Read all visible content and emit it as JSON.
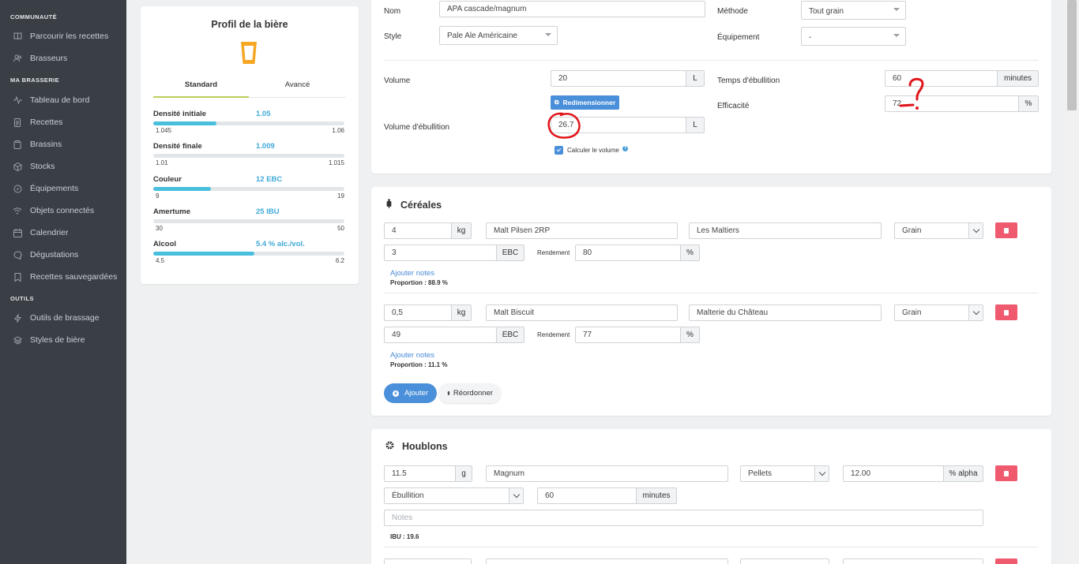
{
  "sidebar": {
    "sections": [
      {
        "label": "COMMUNAUTÉ",
        "items": [
          {
            "label": "Parcourir les recettes",
            "icon": "book-icon"
          },
          {
            "label": "Brasseurs",
            "icon": "users-icon"
          }
        ]
      },
      {
        "label": "MA BRASSERIE",
        "items": [
          {
            "label": "Tableau de bord",
            "icon": "pulse-icon"
          },
          {
            "label": "Recettes",
            "icon": "document-icon"
          },
          {
            "label": "Brassins",
            "icon": "clipboard-icon"
          },
          {
            "label": "Stocks",
            "icon": "box-icon"
          },
          {
            "label": "Équipements",
            "icon": "compass-icon"
          },
          {
            "label": "Objets connectés",
            "icon": "wifi-icon"
          },
          {
            "label": "Calendrier",
            "icon": "calendar-icon"
          },
          {
            "label": "Dégustations",
            "icon": "chat-icon"
          },
          {
            "label": "Recettes sauvegardées",
            "icon": "bookmark-icon"
          }
        ]
      },
      {
        "label": "OUTILS",
        "items": [
          {
            "label": "Outils de brassage",
            "icon": "bolt-icon"
          },
          {
            "label": "Styles de bière",
            "icon": "layers-icon"
          }
        ]
      }
    ]
  },
  "profile": {
    "title": "Profil de la bière",
    "icon": "beer-glass-icon",
    "tabs": [
      "Standard",
      "Avancé"
    ],
    "rows": [
      {
        "label": "Densité initiale",
        "value": "1.05",
        "min": "1.045",
        "max": "1.06",
        "fill": 0.33
      },
      {
        "label": "Densité finale",
        "value": "1.009",
        "min": "1.01",
        "max": "1.015",
        "fill": 0.0
      },
      {
        "label": "Couleur",
        "value": "12 EBC",
        "min": "9",
        "max": "19",
        "fill": 0.3
      },
      {
        "label": "Amertume",
        "value": "25 IBU",
        "min": "30",
        "max": "50",
        "fill": 0.0
      },
      {
        "label": "Alcool",
        "value": "5.4 % alc./vol.",
        "min": "4.5",
        "max": "6.2",
        "fill": 0.53
      }
    ]
  },
  "general": {
    "name_label": "Nom",
    "name_value": "APA cascade/magnum",
    "style_label": "Style",
    "style_value": "Pale Ale Américaine",
    "method_label": "Méthode",
    "method_value": "Tout grain",
    "equipment_label": "Équipement",
    "equipment_value": "-",
    "volume_label": "Volume",
    "volume_value": "20",
    "volume_unit": "L",
    "resize_label": "Redimensionner",
    "boil_volume_label": "Volume d'ébullition",
    "boil_volume_value": "26.7",
    "boil_volume_unit": "L",
    "calc_volume_label": "Calculer le volume",
    "boil_time_label": "Temps d'ébullition",
    "boil_time_value": "60",
    "boil_time_unit": "minutes",
    "efficiency_label": "Efficacité",
    "efficiency_value": "72",
    "efficiency_unit": "%"
  },
  "cereals": {
    "title": "Céréales",
    "items": [
      {
        "qty": "4",
        "qty_unit": "kg",
        "name": "Malt Pilsen 2RP",
        "supplier": "Les Maltiers",
        "type": "Grain",
        "color": "3",
        "color_unit": "EBC",
        "yield_label": "Rendement",
        "yield": "80",
        "yield_unit": "%",
        "notes_link": "Ajouter notes",
        "proportion": "Proportion : 88.9 %"
      },
      {
        "qty": "0,5",
        "qty_unit": "kg",
        "name": "Malt Biscuit",
        "supplier": "Malterie du Château",
        "type": "Grain",
        "color": "49",
        "color_unit": "EBC",
        "yield_label": "Rendement",
        "yield": "77",
        "yield_unit": "%",
        "notes_link": "Ajouter notes",
        "proportion": "Proportion : 11.1 %"
      }
    ],
    "add_label": "Ajouter",
    "reorder_label": "Réordonner"
  },
  "hops": {
    "title": "Houblons",
    "items": [
      {
        "qty": "11.5",
        "qty_unit": "g",
        "name": "Magnum",
        "form": "Pellets",
        "alpha": "12.00",
        "alpha_unit": "% alpha",
        "use": "Ébullition",
        "time": "60",
        "time_unit": "minutes",
        "notes_placeholder": "Notes",
        "ibu": "IBU : 19.6"
      }
    ]
  },
  "colors": {
    "accent": "#4a8fd9",
    "danger": "#ef5a6e",
    "bar": "#47bfdd",
    "sidebar": "#3a3f46",
    "annotation": "#e0161b"
  }
}
